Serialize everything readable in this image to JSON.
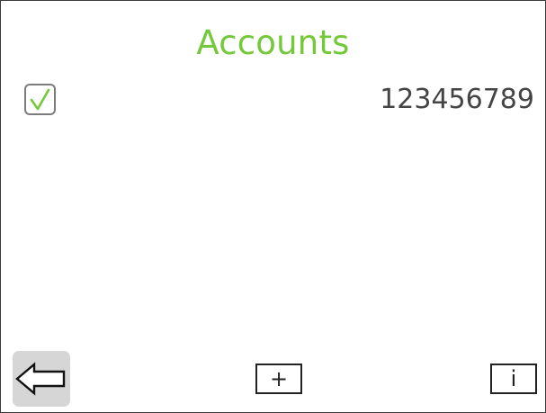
{
  "header": {
    "title": "Accounts",
    "title_color": "#74c93a"
  },
  "accounts": [
    {
      "number": "123456789",
      "selected": true
    }
  ],
  "toolbar": {
    "back_icon": "arrow-left-icon",
    "add_label": "+",
    "info_label": "i"
  }
}
